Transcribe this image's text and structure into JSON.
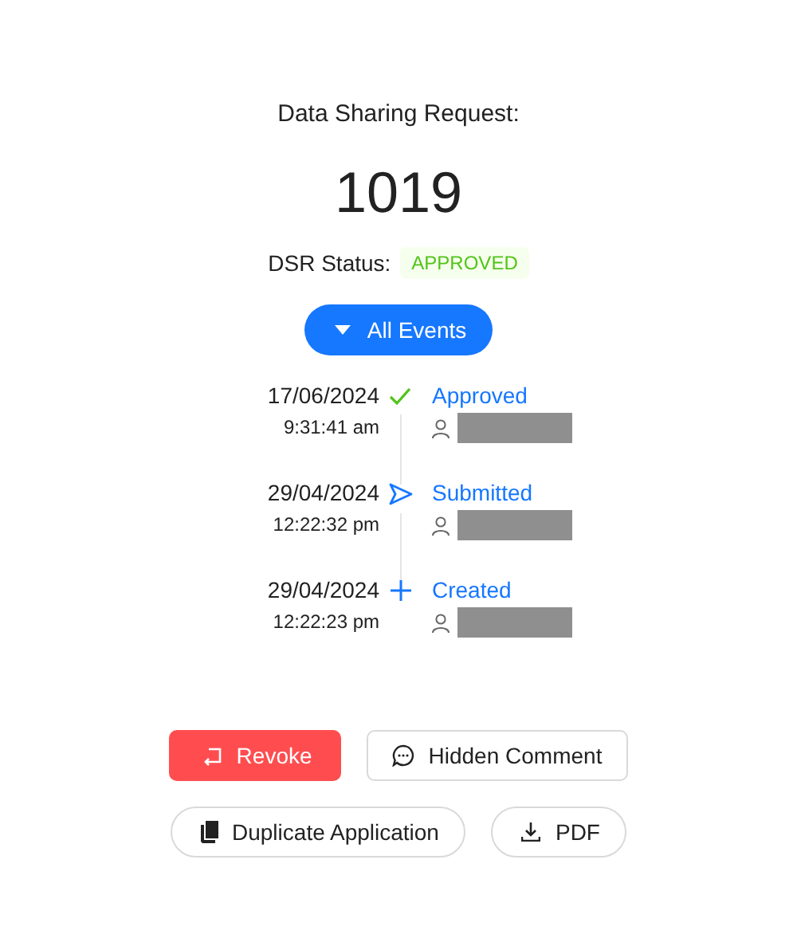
{
  "header": {
    "title": "Data Sharing Request:",
    "number": "1019"
  },
  "status": {
    "label": "DSR Status:",
    "value": "APPROVED",
    "color": "#52c41a"
  },
  "events_button": {
    "label": "All Events",
    "expanded": false
  },
  "events": [
    {
      "kind": "approved",
      "date": "17/06/2024",
      "time": "9:31:41 am",
      "label": "Approved"
    },
    {
      "kind": "submitted",
      "date": "29/04/2024",
      "time": "12:22:32 pm",
      "label": "Submitted"
    },
    {
      "kind": "created",
      "date": "29/04/2024",
      "time": "12:22:23 pm",
      "label": "Created"
    }
  ],
  "action_rows": [
    [
      {
        "kind": "revoke",
        "label": "Revoke"
      },
      {
        "kind": "comment",
        "label": "Hidden Comment"
      }
    ],
    [
      {
        "kind": "duplicate",
        "label": "Duplicate Application"
      },
      {
        "kind": "download",
        "label": "PDF"
      }
    ]
  ]
}
